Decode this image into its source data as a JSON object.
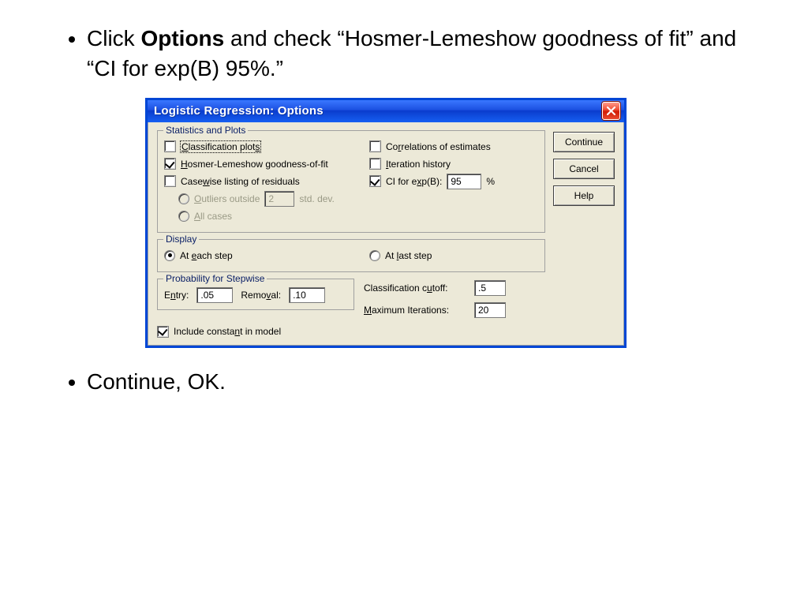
{
  "slide": {
    "bullet1_prefix": "Click ",
    "bullet1_bold": "Options",
    "bullet1_suffix": " and check “Hosmer-Lemeshow goodness of fit” and “CI for exp(B) 95%.”",
    "bullet2": "Continue, OK."
  },
  "dialog": {
    "title": "Logistic Regression: Options",
    "buttons": {
      "continue": "Continue",
      "cancel": "Cancel",
      "help": "Help"
    },
    "groups": {
      "stats": {
        "legend": "Statistics and Plots",
        "classification_plots": {
          "label": "Classification plots",
          "checked": false,
          "accel": "C"
        },
        "hosmer": {
          "label": "Hosmer-Lemeshow goodness-of-fit",
          "checked": true,
          "accel": "H"
        },
        "casewise": {
          "label": "Casewise listing of residuals",
          "checked": false,
          "accel": "w"
        },
        "outliers_outside": {
          "label": "Outliers outside",
          "value": "2",
          "suffix": "std. dev.",
          "accel": "O"
        },
        "all_cases": {
          "label": "All cases",
          "accel": "A"
        },
        "correlations": {
          "label": "Correlations of estimates",
          "checked": false,
          "accel": "r"
        },
        "iteration": {
          "label": "Iteration history",
          "checked": false,
          "accel": "I"
        },
        "ci_expb": {
          "label": "CI for exp(B):",
          "checked": true,
          "value": "95",
          "suffix": "%",
          "accel": "x"
        }
      },
      "display": {
        "legend": "Display",
        "each_step": {
          "label": "At each step",
          "checked": true,
          "accel": "e"
        },
        "last_step": {
          "label": "At last step",
          "checked": false,
          "accel": "l"
        }
      },
      "stepwise": {
        "legend": "Probability for Stepwise",
        "entry": {
          "label": "Entry:",
          "value": ".05",
          "accel": "n"
        },
        "removal": {
          "label": "Removal:",
          "value": ".10",
          "accel": "v"
        }
      },
      "right_fields": {
        "cutoff": {
          "label": "Classification cutoff:",
          "value": ".5",
          "accel": "u"
        },
        "max_iter": {
          "label": "Maximum Iterations:",
          "value": "20",
          "accel": "M"
        }
      },
      "include_constant": {
        "label": "Include constant in model",
        "checked": true,
        "accel": "n"
      }
    }
  }
}
